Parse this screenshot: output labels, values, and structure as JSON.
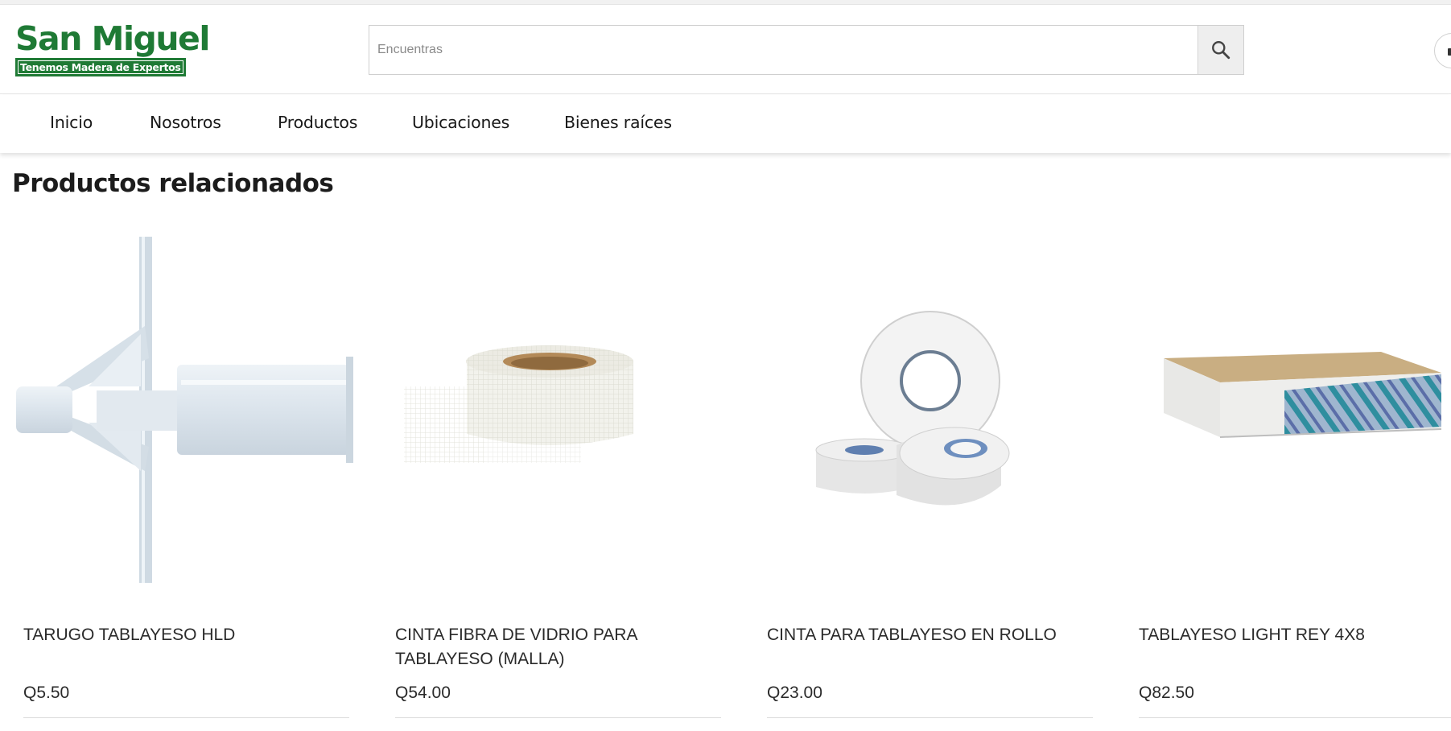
{
  "brand": {
    "name": "San Miguel",
    "tagline": "Tenemos Madera de Expertos",
    "color": "#1f7a35"
  },
  "search": {
    "placeholder": "Encuentras",
    "value": "",
    "icon": "search-icon"
  },
  "nav": {
    "items": [
      {
        "label": "Inicio"
      },
      {
        "label": "Nosotros"
      },
      {
        "label": "Productos"
      },
      {
        "label": "Ubicaciones"
      },
      {
        "label": "Bienes raíces"
      }
    ]
  },
  "related": {
    "title": "Productos relacionados",
    "products": [
      {
        "name": "TARUGO TABLAYESO HLD",
        "price": "Q5.50",
        "image": "plastic-drywall-anchor"
      },
      {
        "name": "CINTA FIBRA DE VIDRIO PARA TABLAYESO (MALLA)",
        "price": "Q54.00",
        "image": "fiberglass-mesh-tape-roll"
      },
      {
        "name": "CINTA PARA TABLAYESO EN ROLLO",
        "price": "Q23.00",
        "image": "paper-drywall-tape-rolls"
      },
      {
        "name": "TABLAYESO LIGHT REY 4X8",
        "price": "Q82.50",
        "image": "drywall-panel-stack"
      }
    ]
  }
}
